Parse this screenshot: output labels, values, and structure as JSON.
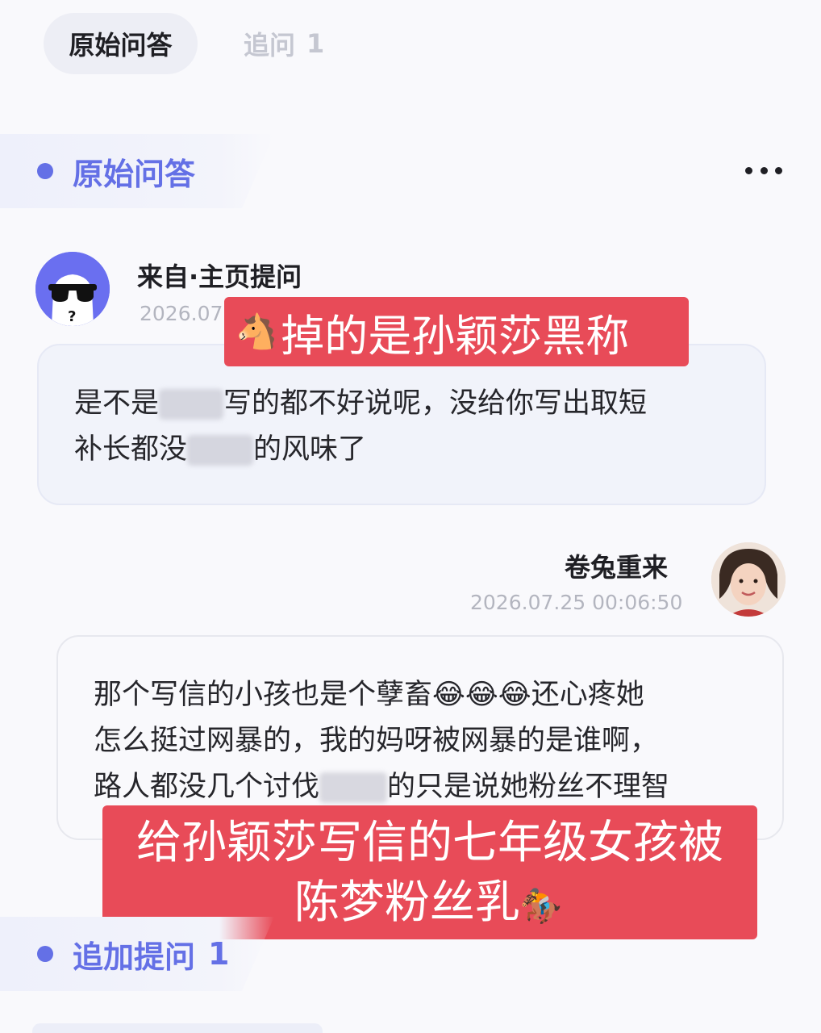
{
  "tabs": {
    "original": "原始问答",
    "followup_label": "追问",
    "followup_count": "1"
  },
  "section_original": {
    "title": "原始问答"
  },
  "question": {
    "source": "来自·主页提问",
    "time": "2026.07",
    "line1_before": "是不是",
    "line1_after": "写的都不好说呢，没给你写出取短",
    "line2_before": "补长都没",
    "line2_after": "的风味了"
  },
  "answer": {
    "name": "卷兔重来",
    "time": "2026.07.25 00:06:50",
    "line1": "那个写信的小孩也是个孽畜😂😂😂还心疼她",
    "line2": "怎么挺过网暴的，我的妈呀被网暴的是谁啊，",
    "line3_before": "路人都没几个讨伐",
    "line3_after": "的只是说她粉丝不理智"
  },
  "caption_top": {
    "emoji": "🐴",
    "text": "掉的是孙颖莎黑称"
  },
  "caption_bottom": {
    "line1": "给孙颖莎写信的七年级女孩被",
    "line2": "陈梦粉丝乳",
    "emoji": "🏇"
  },
  "section_followup": {
    "title": "追加提问",
    "count": "1"
  },
  "colors": {
    "accent": "#6470e6",
    "caption_bg": "#e84b58",
    "bubble_bg": "#f1f3fa"
  },
  "icons": {
    "more": "more-dots-icon",
    "asker_avatar": "sunglasses-avatar-icon"
  }
}
